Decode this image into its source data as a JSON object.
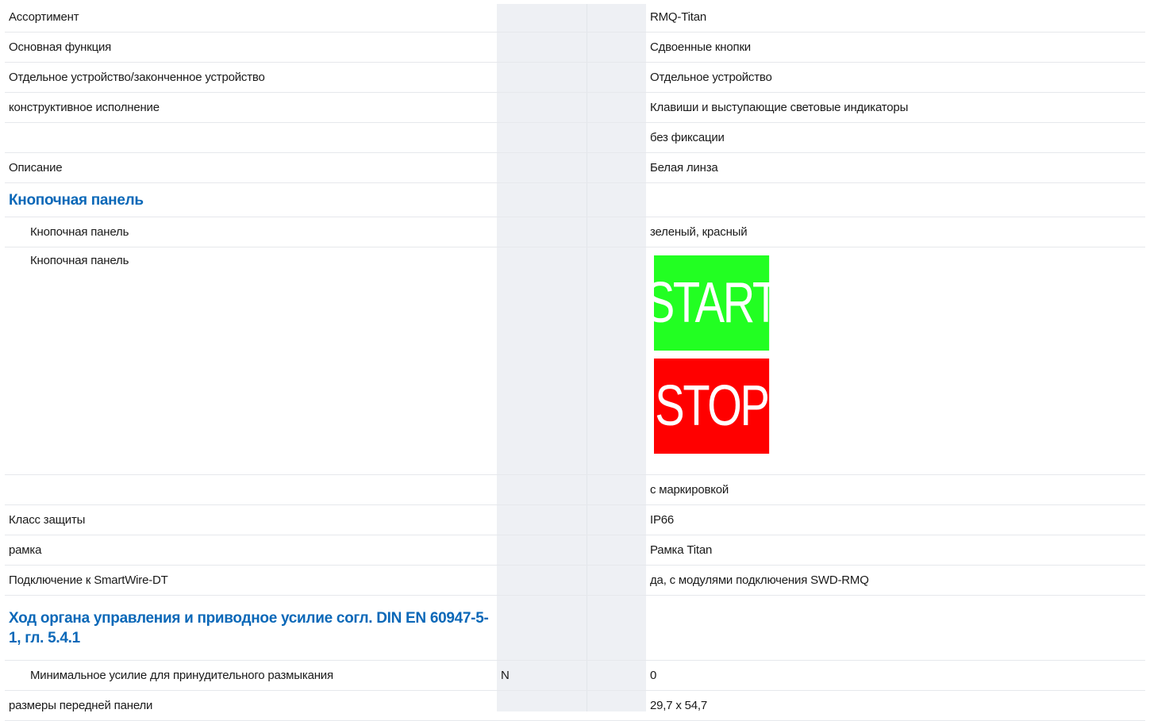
{
  "rows": [
    {
      "label": "Ассортимент",
      "unit": "",
      "value": "RMQ-Titan"
    },
    {
      "label": "Основная функция",
      "unit": "",
      "value": "Сдвоенные кнопки"
    },
    {
      "label": "Отдельное устройство/законченное устройство",
      "unit": "",
      "value": "Отдельное устройство"
    },
    {
      "label": "конструктивное исполнение",
      "unit": "",
      "value": "Клавиши и выступающие световые индикаторы"
    },
    {
      "label": "",
      "unit": "",
      "value": "без фиксации"
    },
    {
      "label": "Описание",
      "unit": "",
      "value": "Белая линза"
    },
    {
      "label": "Кнопочная панель",
      "unit": "",
      "value": ""
    },
    {
      "label": "Кнопочная панель",
      "unit": "",
      "value": "зеленый, красный"
    },
    {
      "label": "Кнопочная панель",
      "unit": "",
      "value": ""
    },
    {
      "label": "",
      "unit": "",
      "value": "с маркировкой"
    },
    {
      "label": "Класс защиты",
      "unit": "",
      "value": "IP66"
    },
    {
      "label": "рамка",
      "unit": "",
      "value": "Рамка Titan"
    },
    {
      "label": "Подключение к SmartWire-DT",
      "unit": "",
      "value": "да, с модулями подключения SWD-RMQ"
    },
    {
      "label": "Ход органа управления и приводное усилие согл. DIN EN 60947-5-1, гл. 5.4.1",
      "unit": "",
      "value": ""
    },
    {
      "label": "Минимальное усилие для принудительного размыкания",
      "unit": "N",
      "value": "0"
    },
    {
      "label": "размеры передней панели",
      "unit": "",
      "value": "29,7 x 54,7"
    }
  ],
  "buttons_image": {
    "start": {
      "label": "START",
      "color": "#22ff22"
    },
    "stop": {
      "label": "STOP",
      "color": "#ff0000"
    }
  },
  "colors": {
    "heading": "#0b68b8",
    "unit_column_bg": "#eef0f4"
  }
}
